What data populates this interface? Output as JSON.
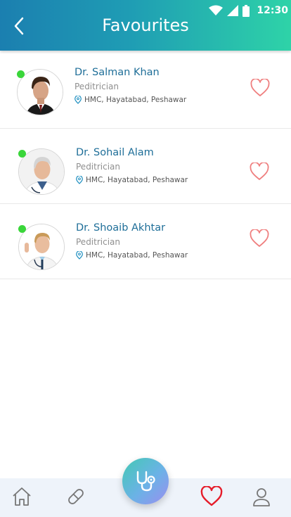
{
  "status_bar": {
    "time": "12:30",
    "icons": [
      "wifi-icon",
      "signal-icon",
      "battery-icon"
    ]
  },
  "header": {
    "title": "Favourites",
    "back_icon": "chevron-left-icon"
  },
  "colors": {
    "name": "#1e6e98",
    "online": "#3ad63a",
    "heart_outline": "#ef7f7f",
    "heart_active": "#e51c2a",
    "header_start": "#1b7fb0",
    "header_end": "#2ed3a8"
  },
  "doctors": [
    {
      "name": "Dr. Salman Khan",
      "specialty": "Peditrician",
      "location": "HMC, Hayatabad, Peshawar",
      "online": true,
      "favourite": true
    },
    {
      "name": "Dr. Sohail Alam",
      "specialty": "Peditrician",
      "location": "HMC, Hayatabad, Peshawar",
      "online": true,
      "favourite": true
    },
    {
      "name": "Dr. Shoaib Akhtar",
      "specialty": "Peditrician",
      "location": "HMC, Hayatabad, Peshawar",
      "online": true,
      "favourite": true
    }
  ],
  "bottom_nav": {
    "items": [
      "home-icon",
      "pill-icon",
      "stethoscope-icon",
      "heart-icon",
      "profile-icon"
    ],
    "active": "heart-icon"
  }
}
